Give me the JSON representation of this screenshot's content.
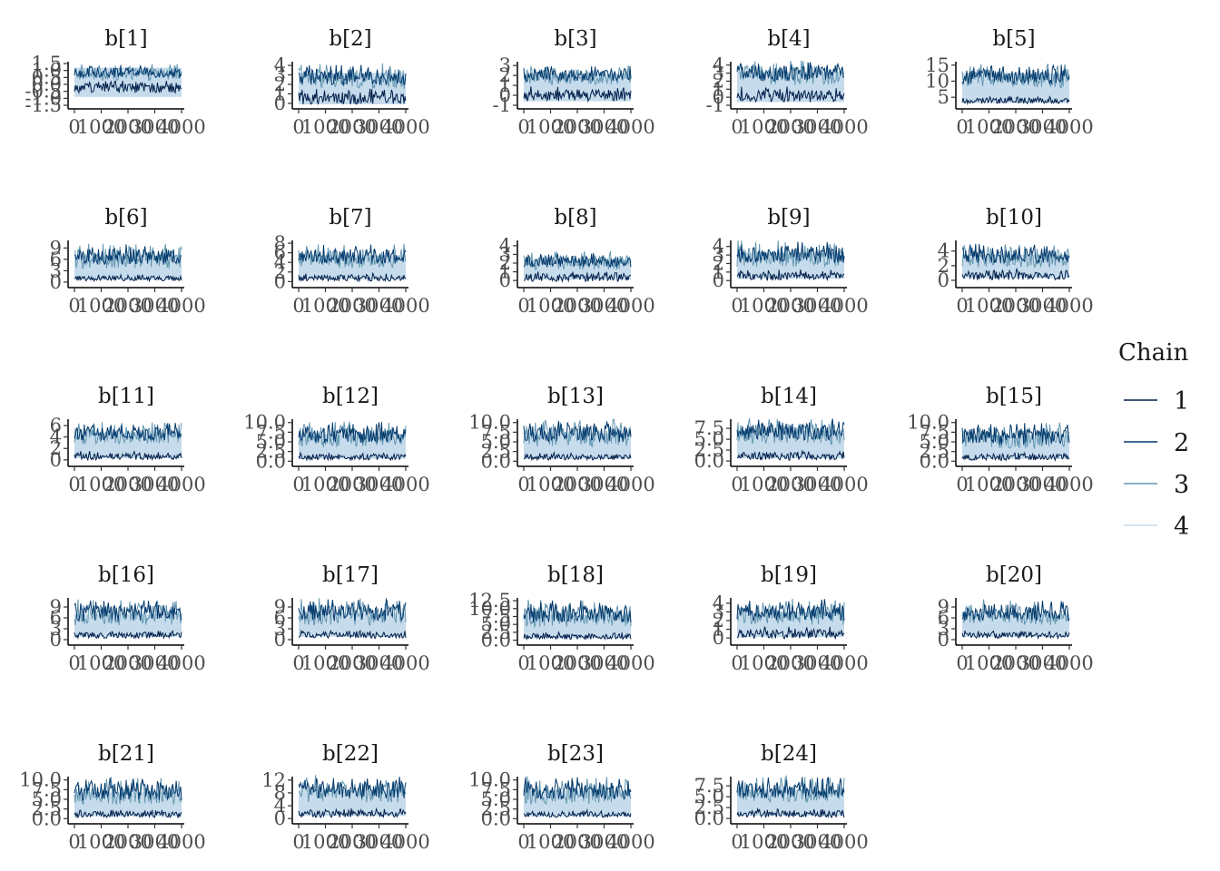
{
  "chart_data": {
    "type": "line",
    "legend": {
      "title": "Chain",
      "position": "right",
      "entries": [
        "1",
        "2",
        "3",
        "4"
      ]
    },
    "series_colors": [
      "#011f4b",
      "#03396c",
      "#6497b1",
      "#c6dbeb"
    ],
    "fill_color": "#c6dbeb",
    "x_range": [
      0,
      4000
    ],
    "x_tick_values": [
      0,
      1000,
      2000,
      3000,
      4000
    ],
    "x_tick_labels": [
      "0",
      "1000",
      "2000",
      "3000",
      "4000"
    ],
    "grid": false,
    "facets": [
      {
        "title": "b[1]",
        "ylim": [
          -1.5,
          1.5
        ],
        "yticks": [
          "-1.5",
          "-1.0",
          "-0.5",
          "0.0",
          "0.5",
          "1.0",
          "1.5"
        ],
        "ytick_values": [
          -1.5,
          -1.0,
          -0.5,
          0.0,
          0.5,
          1.0,
          1.5
        ],
        "band": [
          -0.9,
          1.2
        ],
        "lo": [
          -0.6,
          0.1
        ],
        "hi": [
          0.3,
          1.2
        ]
      },
      {
        "title": "b[2]",
        "ylim": [
          -0.2,
          4.2
        ],
        "yticks": [
          "0",
          "1",
          "2",
          "3",
          "4"
        ],
        "ytick_values": [
          0,
          1,
          2,
          3,
          4
        ],
        "band": [
          -0.1,
          3.2
        ],
        "lo": [
          -0.1,
          1.2
        ],
        "hi": [
          1.5,
          3.6
        ]
      },
      {
        "title": "b[3]",
        "ylim": [
          -1.0,
          3.2
        ],
        "yticks": [
          "-1",
          "0",
          "1",
          "2",
          "3"
        ],
        "ytick_values": [
          -1,
          0,
          1,
          2,
          3
        ],
        "band": [
          -0.6,
          2.2
        ],
        "lo": [
          -0.6,
          0.6
        ],
        "hi": [
          1.1,
          2.6
        ]
      },
      {
        "title": "b[4]",
        "ylim": [
          -1.0,
          4.2
        ],
        "yticks": [
          "-1",
          "0",
          "1",
          "2",
          "3",
          "4"
        ],
        "ytick_values": [
          -1,
          0,
          1,
          2,
          3,
          4
        ],
        "band": [
          -0.6,
          3.2
        ],
        "lo": [
          -0.6,
          0.9
        ],
        "hi": [
          1.5,
          3.9
        ]
      },
      {
        "title": "b[5]",
        "ylim": [
          2.5,
          15.5
        ],
        "yticks": [
          "5",
          "10",
          "15"
        ],
        "ytick_values": [
          5,
          10,
          15
        ],
        "band": [
          3.2,
          12.5
        ],
        "lo": [
          3.0,
          4.8
        ],
        "hi": [
          8.0,
          13.8
        ]
      },
      {
        "title": "b[6]",
        "ylim": [
          -0.5,
          10.5
        ],
        "yticks": [
          "0",
          "3",
          "6",
          "9"
        ],
        "ytick_values": [
          0,
          3,
          6,
          9
        ],
        "band": [
          0.6,
          7.0
        ],
        "lo": [
          0.3,
          1.6
        ],
        "hi": [
          3.5,
          8.8
        ]
      },
      {
        "title": "b[7]",
        "ylim": [
          -0.5,
          8.2
        ],
        "yticks": [
          "0",
          "2",
          "4",
          "6",
          "8"
        ],
        "ytick_values": [
          0,
          2,
          4,
          6,
          8
        ],
        "band": [
          0.5,
          5.5
        ],
        "lo": [
          0.1,
          1.4
        ],
        "hi": [
          2.8,
          6.8
        ]
      },
      {
        "title": "b[8]",
        "ylim": [
          -0.4,
          4.4
        ],
        "yticks": [
          "0",
          "1",
          "2",
          "3",
          "4"
        ],
        "ytick_values": [
          0,
          1,
          2,
          3,
          4
        ],
        "band": [
          0.1,
          2.4
        ],
        "lo": [
          -0.1,
          0.8
        ],
        "hi": [
          1.2,
          2.9
        ]
      },
      {
        "title": "b[9]",
        "ylim": [
          -0.4,
          4.5
        ],
        "yticks": [
          "0",
          "1",
          "2",
          "3",
          "4"
        ],
        "ytick_values": [
          0,
          1,
          2,
          3,
          4
        ],
        "band": [
          0.2,
          3.3
        ],
        "lo": [
          0.0,
          1.0
        ],
        "hi": [
          1.6,
          4.0
        ]
      },
      {
        "title": "b[10]",
        "ylim": [
          -0.5,
          5.2
        ],
        "yticks": [
          "0",
          "2",
          "4"
        ],
        "ytick_values": [
          0,
          2,
          4
        ],
        "band": [
          0.3,
          3.5
        ],
        "lo": [
          0.0,
          1.2
        ],
        "hi": [
          1.8,
          4.4
        ]
      },
      {
        "title": "b[11]",
        "ylim": [
          -0.5,
          6.8
        ],
        "yticks": [
          "0",
          "2",
          "4",
          "6"
        ],
        "ytick_values": [
          0,
          2,
          4,
          6
        ],
        "band": [
          0.3,
          4.8
        ],
        "lo": [
          0.0,
          1.2
        ],
        "hi": [
          2.8,
          5.8
        ]
      },
      {
        "title": "b[12]",
        "ylim": [
          -0.4,
          10.4
        ],
        "yticks": [
          "0.0",
          "2.5",
          "5.0",
          "7.5",
          "10.0"
        ],
        "ytick_values": [
          0,
          2.5,
          5,
          7.5,
          10
        ],
        "band": [
          0.6,
          7.0
        ],
        "lo": [
          0.3,
          1.8
        ],
        "hi": [
          3.5,
          9.0
        ]
      },
      {
        "title": "b[13]",
        "ylim": [
          -0.4,
          10.4
        ],
        "yticks": [
          "0.0",
          "2.5",
          "5.0",
          "7.5",
          "10.0"
        ],
        "ytick_values": [
          0,
          2.5,
          5,
          7.5,
          10
        ],
        "band": [
          0.6,
          7.2
        ],
        "lo": [
          0.3,
          1.8
        ],
        "hi": [
          3.8,
          9.2
        ]
      },
      {
        "title": "b[14]",
        "ylim": [
          -0.4,
          9.2
        ],
        "yticks": [
          "0.0",
          "2.5",
          "5.0",
          "7.5"
        ],
        "ytick_values": [
          0,
          2.5,
          5,
          7.5
        ],
        "band": [
          0.6,
          7.0
        ],
        "lo": [
          0.2,
          1.8
        ],
        "hi": [
          3.8,
          8.6
        ]
      },
      {
        "title": "b[15]",
        "ylim": [
          -0.4,
          10.4
        ],
        "yticks": [
          "0.0",
          "2.5",
          "5.0",
          "7.5",
          "10.0"
        ],
        "ytick_values": [
          0,
          2.5,
          5,
          7.5,
          10
        ],
        "band": [
          0.6,
          6.6
        ],
        "lo": [
          0.2,
          1.8
        ],
        "hi": [
          3.2,
          8.6
        ]
      },
      {
        "title": "b[16]",
        "ylim": [
          -0.5,
          11.0
        ],
        "yticks": [
          "0",
          "3",
          "6",
          "9"
        ],
        "ytick_values": [
          0,
          3,
          6,
          9
        ],
        "band": [
          0.8,
          7.0
        ],
        "lo": [
          0.4,
          2.0
        ],
        "hi": [
          4.0,
          9.6
        ]
      },
      {
        "title": "b[17]",
        "ylim": [
          -0.5,
          11.0
        ],
        "yticks": [
          "0",
          "3",
          "6",
          "9"
        ],
        "ytick_values": [
          0,
          3,
          6,
          9
        ],
        "band": [
          0.8,
          7.2
        ],
        "lo": [
          0.4,
          2.0
        ],
        "hi": [
          4.0,
          9.8
        ]
      },
      {
        "title": "b[18]",
        "ylim": [
          -0.4,
          12.8
        ],
        "yticks": [
          "0.0",
          "2.5",
          "5.0",
          "7.5",
          "10.0",
          "12.5"
        ],
        "ytick_values": [
          0,
          2.5,
          5,
          7.5,
          10,
          12.5
        ],
        "band": [
          0.6,
          8.0
        ],
        "lo": [
          0.3,
          2.0
        ],
        "hi": [
          4.2,
          11.0
        ]
      },
      {
        "title": "b[19]",
        "ylim": [
          -0.4,
          4.4
        ],
        "yticks": [
          "0",
          "1",
          "2",
          "3",
          "4"
        ],
        "ytick_values": [
          0,
          1,
          2,
          3,
          4
        ],
        "band": [
          0.1,
          3.0
        ],
        "lo": [
          -0.1,
          1.0
        ],
        "hi": [
          1.5,
          3.9
        ]
      },
      {
        "title": "b[20]",
        "ylim": [
          -0.5,
          11.0
        ],
        "yticks": [
          "0",
          "3",
          "6",
          "9"
        ],
        "ytick_values": [
          0,
          3,
          6,
          9
        ],
        "band": [
          0.8,
          7.0
        ],
        "lo": [
          0.4,
          2.0
        ],
        "hi": [
          4.0,
          9.6
        ]
      },
      {
        "title": "b[21]",
        "ylim": [
          -0.4,
          10.4
        ],
        "yticks": [
          "0.0",
          "2.5",
          "5.0",
          "7.5",
          "10.0"
        ],
        "ytick_values": [
          0,
          2.5,
          5,
          7.5,
          10
        ],
        "band": [
          0.6,
          6.8
        ],
        "lo": [
          0.3,
          1.8
        ],
        "hi": [
          3.6,
          9.2
        ]
      },
      {
        "title": "b[22]",
        "ylim": [
          -0.5,
          12.5
        ],
        "yticks": [
          "0",
          "4",
          "8",
          "12"
        ],
        "ytick_values": [
          0,
          4,
          8,
          12
        ],
        "band": [
          0.8,
          9.0
        ],
        "lo": [
          0.4,
          2.6
        ],
        "hi": [
          5.0,
          11.6
        ]
      },
      {
        "title": "b[23]",
        "ylim": [
          -0.4,
          10.4
        ],
        "yticks": [
          "0.0",
          "2.5",
          "5.0",
          "7.5",
          "10.0"
        ],
        "ytick_values": [
          0,
          2.5,
          5,
          7.5,
          10
        ],
        "band": [
          0.6,
          7.2
        ],
        "lo": [
          0.3,
          1.8
        ],
        "hi": [
          3.8,
          9.4
        ]
      },
      {
        "title": "b[24]",
        "ylim": [
          -0.4,
          9.2
        ],
        "yticks": [
          "0.0",
          "2.5",
          "5.0",
          "7.5"
        ],
        "ytick_values": [
          0,
          2.5,
          5,
          7.5
        ],
        "band": [
          0.6,
          6.6
        ],
        "lo": [
          0.2,
          1.8
        ],
        "hi": [
          3.6,
          8.4
        ]
      }
    ]
  }
}
